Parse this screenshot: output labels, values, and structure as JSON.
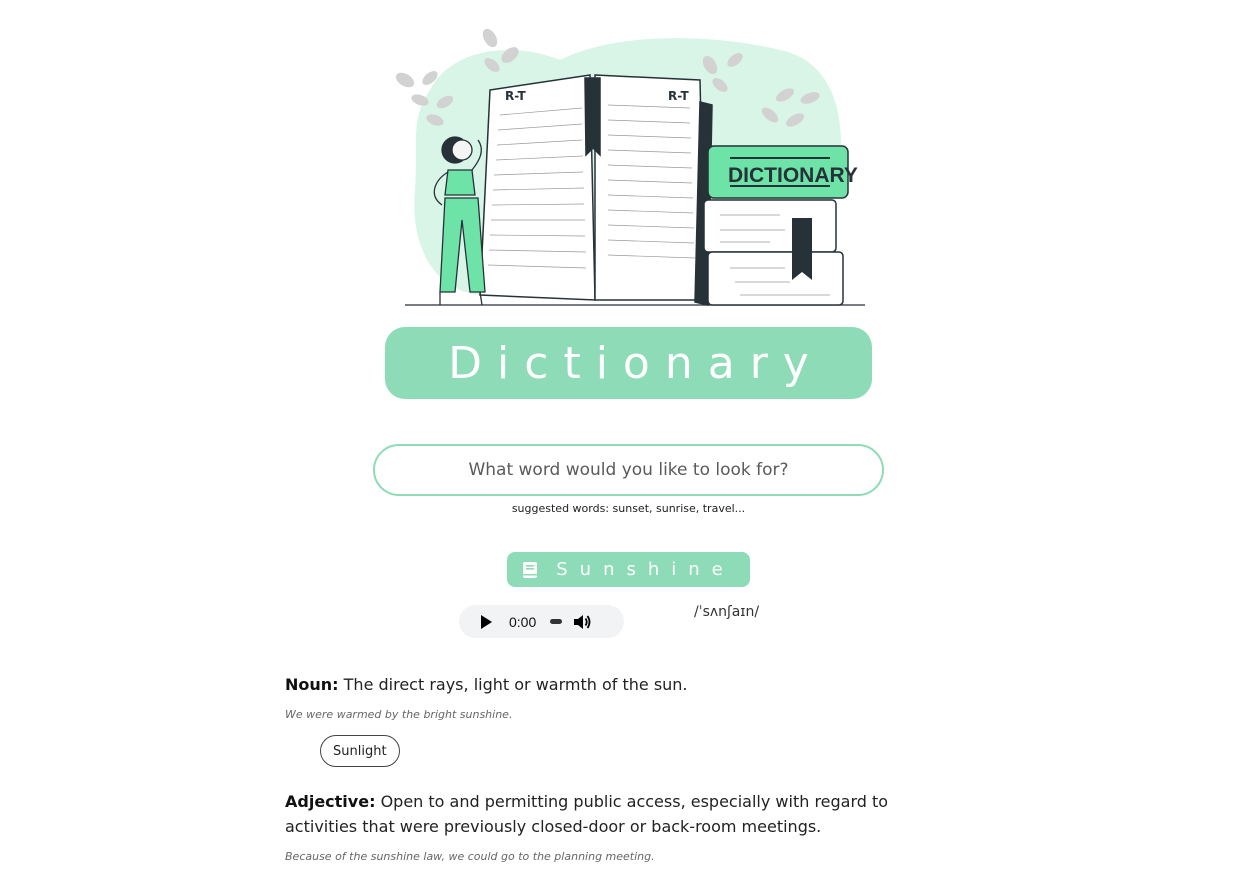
{
  "hero": {
    "book_page_label_left": "R-T",
    "book_page_label_right": "R-T",
    "spine_label": "DICTIONARY"
  },
  "title": "Dictionary",
  "search": {
    "placeholder": "What word would you like to look for?",
    "value": ""
  },
  "suggested": "suggested words: sunset, sunrise, travel...",
  "result": {
    "word": "Sunshine",
    "phonetic": "/ˈsʌnʃaɪn/",
    "audio": {
      "time": "0:00"
    },
    "meanings": [
      {
        "part_of_speech": "Noun:",
        "definition": "The direct rays, light or warmth of the sun.",
        "example": "We were warmed by the bright sunshine.",
        "synonyms": [
          "Sunlight"
        ]
      },
      {
        "part_of_speech": "Adjective:",
        "definition": "Open to and permitting public access, especially with regard to activities that were previously closed-door or back-room meetings.",
        "example": "Because of the sunshine law, we could go to the planning meeting."
      }
    ]
  },
  "colors": {
    "accent": "#8ddbb7",
    "blob": "#d8f5e8",
    "dark": "#263238"
  }
}
